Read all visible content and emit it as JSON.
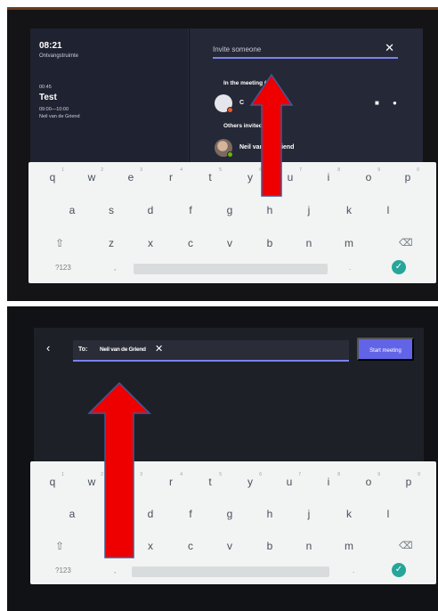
{
  "top": {
    "time": "08:21",
    "room": "Ontvangstruimte",
    "duration": "00:45",
    "meeting_title": "Test",
    "meeting_hours": "09:00—10:00",
    "organizer": "Neil van de Griend",
    "invite_placeholder": "Invite someone",
    "close_label": "✕",
    "in_meeting_label": "In the meeting (1)",
    "in_meeting_person": "C",
    "others_invited_label": "Others invited",
    "invited_person": "Neil van de Griend"
  },
  "bottom": {
    "back_label": "‹",
    "to_label": "To:",
    "recipient": "Neil van de Griend",
    "remove_label": "✕",
    "start_meeting_label": "Start meeting"
  },
  "keyboard": {
    "row1": [
      "q",
      "w",
      "e",
      "r",
      "t",
      "y",
      "u",
      "i",
      "o",
      "p"
    ],
    "row1_hints": [
      "1",
      "2",
      "3",
      "4",
      "5",
      "6",
      "7",
      "8",
      "9",
      "0"
    ],
    "row2": [
      "a",
      "s",
      "d",
      "f",
      "g",
      "h",
      "j",
      "k",
      "l"
    ],
    "row3": [
      "z",
      "x",
      "c",
      "v",
      "b",
      "n",
      "m"
    ],
    "shift_icon": "⇧",
    "backspace_icon": "⌫",
    "numbers_label": "?123",
    "comma_label": ",",
    "period_label": ".",
    "enter_icon": "✓"
  },
  "colors": {
    "accent": "#7b83eb",
    "start_button": "#6264e7",
    "enter_key": "#26a69a",
    "arrow_fill": "#ee0000",
    "arrow_stroke": "#3a5a9c"
  },
  "icons": [
    "close-icon",
    "video-icon",
    "microphone-icon",
    "back-chevron-icon",
    "shift-icon",
    "backspace-icon",
    "check-icon",
    "up-arrow-annotation"
  ]
}
